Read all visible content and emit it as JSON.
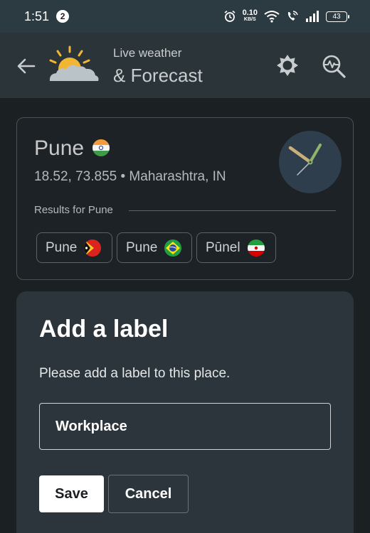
{
  "status_bar": {
    "time": "1:51",
    "notification_count": "2",
    "net_speed_value": "0.10",
    "net_speed_unit": "KB/S",
    "battery": "43"
  },
  "app_bar": {
    "title_line1": "Live weather",
    "title_line2": "& Forecast",
    "icons": [
      "back-arrow-icon",
      "sun-cloud-logo-icon",
      "settings-sun-icon",
      "search-weather-icon"
    ]
  },
  "location": {
    "name": "Pune",
    "coords_region": "18.52, 73.855 • Maharashtra, IN",
    "results_label": "Results for Pune",
    "results": [
      {
        "label": "Pune",
        "flag": "East Timor"
      },
      {
        "label": "Pune",
        "flag": "Brazil"
      },
      {
        "label": "Pūnel",
        "flag": "Iran"
      }
    ]
  },
  "dialog": {
    "title": "Add a label",
    "message": "Please add a label to this place.",
    "input_value": "Workplace",
    "save_label": "Save",
    "cancel_label": "Cancel"
  },
  "colors": {
    "background": "#1b2023",
    "app_bar": "#2a3439",
    "status_bar": "#2c3a41",
    "dialog": "#2b353b",
    "logo_sun": "#f2b632",
    "clock_face": "#2e3e4c"
  }
}
